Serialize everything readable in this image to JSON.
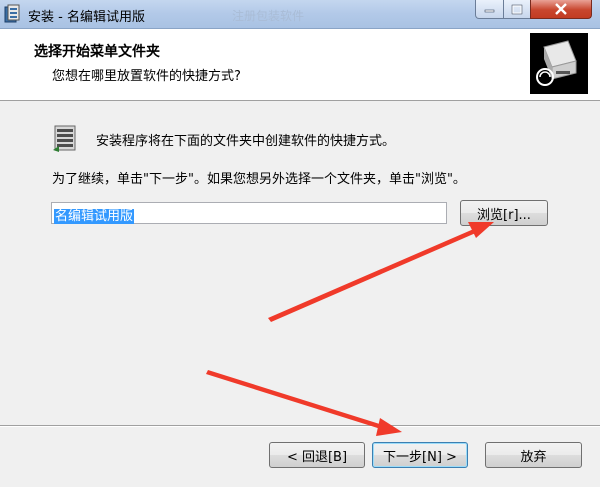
{
  "window": {
    "title": "安装 - 名编辑试用版",
    "ghost_title": "注册包装软件"
  },
  "header": {
    "title": "选择开始菜单文件夹",
    "subtitle": "您想在哪里放置软件的快捷方式?"
  },
  "body": {
    "info_text": "安装程序将在下面的文件夹中创建软件的快捷方式。",
    "continue_text": "为了继续，单击\"下一步\"。如果您想另外选择一个文件夹，单击\"浏览\"。",
    "folder_value": "名编辑试用版",
    "browse_label": "浏览[r]..."
  },
  "buttons": {
    "back_label": "< 回退[B]",
    "next_label": "下一步[N] >",
    "cancel_label": "放弃"
  },
  "colors": {
    "annotation_arrow": "#f03a2a",
    "selection": "#3399ff",
    "close_button": "#c8462e"
  }
}
